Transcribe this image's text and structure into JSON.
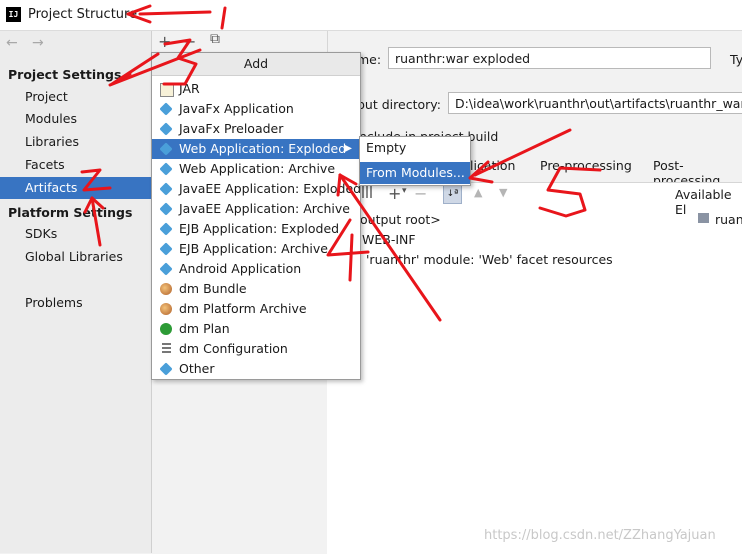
{
  "window": {
    "title": "Project Structure",
    "app_icon_text": "IJ"
  },
  "toolbar": {
    "add": "+",
    "remove": "−",
    "copy": "⧉"
  },
  "sidebar": {
    "back": "←",
    "forward": "→",
    "project_settings": "Project Settings",
    "project_items": [
      "Project",
      "Modules",
      "Libraries",
      "Facets",
      "Artifacts"
    ],
    "platform_settings": "Platform Settings",
    "platform_items": [
      "SDKs",
      "Global Libraries"
    ],
    "problems": "Problems",
    "selected": "Artifacts"
  },
  "main": {
    "name_label": "me:",
    "name_value": "ruanthr:war exploded",
    "type_label": "Ty",
    "output_label": "put directory:",
    "output_value": "D:\\idea\\work\\ruanthr\\out\\artifacts\\ruanthr_war_ex",
    "include_label": "nclude in project build",
    "tabs": [
      "lication",
      "Pre-processing",
      "Post-processing"
    ],
    "available": "Available El",
    "tree": [
      "output root>",
      "WEB-INF",
      "'ruanthr' module: 'Web' facet resources"
    ],
    "right_tree_item": "ruant"
  },
  "popup": {
    "header": "Add",
    "items": [
      {
        "label": "JAR",
        "icon": "jar-icon"
      },
      {
        "label": "JavaFx Application",
        "icon": "javafx-icon"
      },
      {
        "label": "JavaFx Preloader",
        "icon": "javafx-icon"
      },
      {
        "label": "Web Application: Exploded",
        "icon": "web-icon",
        "selected": true
      },
      {
        "label": "Web Application: Archive",
        "icon": "web-icon"
      },
      {
        "label": "JavaEE Application: Exploded",
        "icon": "javaee-icon"
      },
      {
        "label": "JavaEE Application: Archive",
        "icon": "javaee-icon"
      },
      {
        "label": "EJB Application: Exploded",
        "icon": "ejb-icon"
      },
      {
        "label": "EJB Application: Archive",
        "icon": "ejb-icon"
      },
      {
        "label": "Android Application",
        "icon": "android-icon"
      },
      {
        "label": "dm Bundle",
        "icon": "dm-icon"
      },
      {
        "label": "dm Platform Archive",
        "icon": "dm-icon"
      },
      {
        "label": "dm Plan",
        "icon": "plan-icon"
      },
      {
        "label": "dm Configuration",
        "icon": "config-icon"
      },
      {
        "label": "Other",
        "icon": "other-icon"
      }
    ]
  },
  "submenu": {
    "items": [
      "Empty",
      "From Modules..."
    ]
  },
  "annotations": [
    "1",
    "2",
    "3",
    "4",
    "5"
  ],
  "watermark": "https://blog.csdn.net/ZZhangYajuan",
  "colors": {
    "selection": "#3874c2",
    "annotation": "#e8151b"
  }
}
